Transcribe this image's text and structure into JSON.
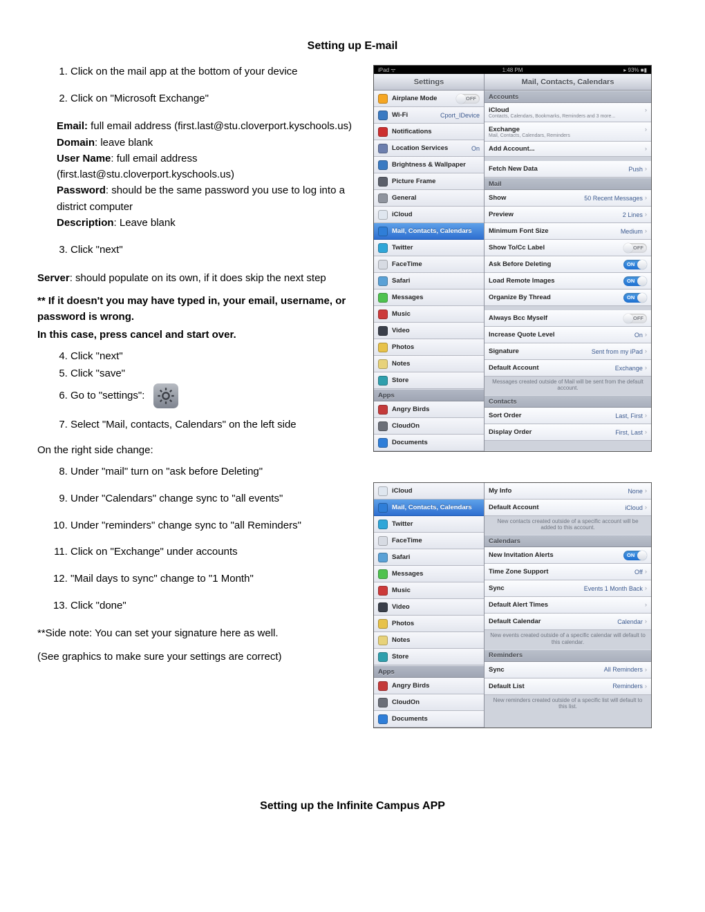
{
  "title1": "Setting up E-mail",
  "title2": "Setting up the Infinite Campus APP",
  "steps_a": [
    "Click on the mail app at the bottom of your device",
    "Click on \"Microsoft Exchange\""
  ],
  "fields": {
    "email_l": "Email:",
    "email_v": " full email address (first.last@stu.cloverport.kyschools.us)",
    "domain_l": "Domain",
    "domain_v": ": leave blank",
    "user_l": "User Name",
    "user_v": ": full email address (first.last@stu.cloverport.kyschools.us)",
    "pass_l": "Password",
    "pass_v": ": should be the same password you use to log into a district computer",
    "desc_l": "Description",
    "desc_v": ": Leave blank"
  },
  "steps_b": [
    "Click \"next\""
  ],
  "server_l": "Server",
  "server_v": ": should populate on its own, if it does skip the next step",
  "warn1": "** If it doesn't you may have typed in, your email, username, or password is wrong.",
  "warn2": " In this case, press cancel and start over.",
  "steps_c": [
    "Click \"next\"",
    "Click \"save\"",
    "Go to \"settings\":",
    "Select \"Mail, contacts, Calendars\" on the left side"
  ],
  "rightside": "On the right side change:",
  "steps_d": [
    "Under \"mail\" turn on \"ask before Deleting\"",
    "Under \"Calendars\" change sync to \"all events\"",
    "Under \"reminders\" change sync to \"all Reminders\"",
    "Click on \"Exchange\" under accounts",
    "\"Mail days to sync\" change to \"1 Month\"",
    "Click \"done\""
  ],
  "sidenote": "**Side note: You can set your signature here as well.",
  "see": "(See graphics to make sure your settings are correct)",
  "status": {
    "left": "iPad ᯤ",
    "time": "1:48 PM",
    "right": "▸ 93% ■▮"
  },
  "sidebar_title": "Settings",
  "content_title": "Mail, Contacts, Calendars",
  "side1": [
    {
      "lbl": "Airplane Mode",
      "toggle": "off",
      "c": "#f5a623"
    },
    {
      "lbl": "Wi-Fi",
      "val": "Cport_IDevice",
      "c": "#3a7ac2"
    },
    {
      "lbl": "Notifications",
      "c": "#cc2f2f"
    },
    {
      "lbl": "Location Services",
      "val": "On",
      "c": "#6d7fae"
    },
    {
      "lbl": "Brightness & Wallpaper",
      "c": "#3a7ac2"
    },
    {
      "lbl": "Picture Frame",
      "c": "#5b5f6a"
    },
    {
      "lbl": "General",
      "c": "#8f949e"
    },
    {
      "lbl": "iCloud",
      "c": "#dfe6ef"
    },
    {
      "lbl": "Mail, Contacts, Calendars",
      "sel": true,
      "c": "#2f7ed8"
    },
    {
      "lbl": "Twitter",
      "c": "#2fa6d8"
    },
    {
      "lbl": "FaceTime",
      "c": "#d7dbe3"
    },
    {
      "lbl": "Safari",
      "c": "#5aa1d6"
    },
    {
      "lbl": "Messages",
      "c": "#4fc24f"
    },
    {
      "lbl": "Music",
      "c": "#cc3a3a"
    },
    {
      "lbl": "Video",
      "c": "#3a3f4a"
    },
    {
      "lbl": "Photos",
      "c": "#e7c24a"
    },
    {
      "lbl": "Notes",
      "c": "#e7d27a"
    },
    {
      "lbl": "Store",
      "c": "#2f9fad"
    }
  ],
  "side1_apps_head": "Apps",
  "side1_apps": [
    {
      "lbl": "Angry Birds",
      "c": "#c43a3a"
    },
    {
      "lbl": "CloudOn",
      "c": "#6b6f78"
    },
    {
      "lbl": "Documents",
      "c": "#2f7ed8"
    }
  ],
  "acct_head": "Accounts",
  "acct": [
    {
      "lbl": "iCloud",
      "sub": "Contacts, Calendars, Bookmarks, Reminders and 3 more..."
    },
    {
      "lbl": "Exchange",
      "sub": "Mail, Contacts, Calendars, Reminders"
    },
    {
      "lbl": "Add Account..."
    }
  ],
  "fetch": {
    "lbl": "Fetch New Data",
    "val": "Push"
  },
  "mail_head": "Mail",
  "mail_rows": [
    {
      "lbl": "Show",
      "val": "50 Recent Messages"
    },
    {
      "lbl": "Preview",
      "val": "2 Lines"
    },
    {
      "lbl": "Minimum Font Size",
      "val": "Medium"
    },
    {
      "lbl": "Show To/Cc Label",
      "toggle": "off"
    },
    {
      "lbl": "Ask Before Deleting",
      "toggle": "on"
    },
    {
      "lbl": "Load Remote Images",
      "toggle": "on"
    },
    {
      "lbl": "Organize By Thread",
      "toggle": "on"
    }
  ],
  "mail_rows2": [
    {
      "lbl": "Always Bcc Myself",
      "toggle": "off"
    },
    {
      "lbl": "Increase Quote Level",
      "val": "On"
    },
    {
      "lbl": "Signature",
      "val": "Sent from my iPad"
    },
    {
      "lbl": "Default Account",
      "val": "Exchange"
    }
  ],
  "mail_foot": "Messages created outside of Mail will be sent from the default account.",
  "contacts_head": "Contacts",
  "contacts_rows": [
    {
      "lbl": "Sort Order",
      "val": "Last, First"
    },
    {
      "lbl": "Display Order",
      "val": "First, Last"
    }
  ],
  "side2": [
    {
      "lbl": "iCloud",
      "c": "#dfe6ef"
    },
    {
      "lbl": "Mail, Contacts, Calendars",
      "sel": true,
      "c": "#2f7ed8"
    },
    {
      "lbl": "Twitter",
      "c": "#2fa6d8"
    },
    {
      "lbl": "FaceTime",
      "c": "#d7dbe3"
    },
    {
      "lbl": "Safari",
      "c": "#5aa1d6"
    },
    {
      "lbl": "Messages",
      "c": "#4fc24f"
    },
    {
      "lbl": "Music",
      "c": "#cc3a3a"
    },
    {
      "lbl": "Video",
      "c": "#3a3f4a"
    },
    {
      "lbl": "Photos",
      "c": "#e7c24a"
    },
    {
      "lbl": "Notes",
      "c": "#e7d27a"
    },
    {
      "lbl": "Store",
      "c": "#2f9fad"
    }
  ],
  "side2_apps": [
    {
      "lbl": "Angry Birds",
      "c": "#c43a3a"
    },
    {
      "lbl": "CloudOn",
      "c": "#6b6f78"
    },
    {
      "lbl": "Documents",
      "c": "#2f7ed8"
    }
  ],
  "c2_rows1": [
    {
      "lbl": "My Info",
      "val": "None"
    },
    {
      "lbl": "Default Account",
      "val": "iCloud"
    }
  ],
  "c2_foot1": "New contacts created outside of a specific account will be added to this account.",
  "cal_head": "Calendars",
  "cal_rows": [
    {
      "lbl": "New Invitation Alerts",
      "toggle": "on"
    },
    {
      "lbl": "Time Zone Support",
      "val": "Off"
    },
    {
      "lbl": "Sync",
      "val": "Events 1 Month Back"
    },
    {
      "lbl": "Default Alert Times",
      "val": ""
    },
    {
      "lbl": "Default Calendar",
      "val": "Calendar"
    }
  ],
  "c2_foot2": "New events created outside of a specific calendar will default to this calendar.",
  "rem_head": "Reminders",
  "rem_rows": [
    {
      "lbl": "Sync",
      "val": "All Reminders"
    },
    {
      "lbl": "Default List",
      "val": "Reminders"
    }
  ],
  "c2_foot3": "New reminders created outside of a specific list will default to this list.",
  "on_txt": "ON",
  "off_txt": "OFF"
}
